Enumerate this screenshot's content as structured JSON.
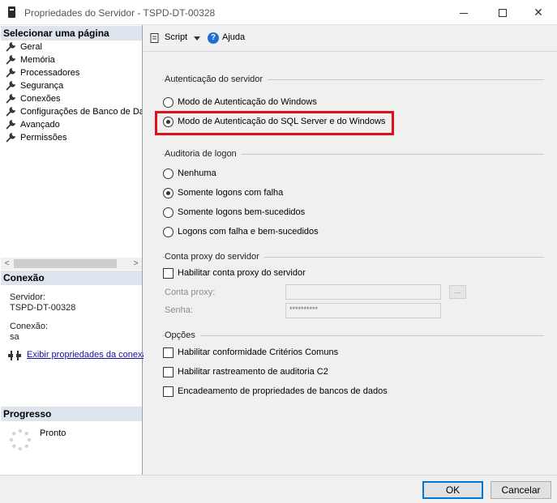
{
  "window": {
    "title": "Propriedades do Servidor - TSPD-DT-00328",
    "close_glyph": "✕"
  },
  "sidebar": {
    "select_page_header": "Selecionar uma página",
    "pages": [
      {
        "label": "Geral"
      },
      {
        "label": "Memória"
      },
      {
        "label": "Processadores"
      },
      {
        "label": "Segurança"
      },
      {
        "label": "Conexões"
      },
      {
        "label": "Configurações de Banco de Da"
      },
      {
        "label": "Avançado"
      },
      {
        "label": "Permissões"
      }
    ],
    "scroll_left": "<",
    "scroll_right": ">",
    "connection": {
      "header": "Conexão",
      "server_label": "Servidor:",
      "server_value": "TSPD-DT-00328",
      "connection_label": "Conexão:",
      "connection_value": "sa",
      "view_link": "Exibir propriedades da conexã"
    },
    "progress": {
      "header": "Progresso",
      "status": "Pronto"
    }
  },
  "toolbar": {
    "script_label": "Script",
    "help_label": "Ajuda",
    "help_glyph": "?"
  },
  "auth": {
    "title": "Autenticação do servidor",
    "options": [
      {
        "label": "Modo de Autenticação do Windows",
        "selected": false
      },
      {
        "label": "Modo de Autenticação do SQL Server e do Windows",
        "selected": true
      }
    ]
  },
  "audit": {
    "title": "Auditoria de logon",
    "options": [
      {
        "label": "Nenhuma",
        "selected": false
      },
      {
        "label": "Somente logons com falha",
        "selected": true
      },
      {
        "label": "Somente logons bem-sucedidos",
        "selected": false
      },
      {
        "label": "Logons com falha e bem-sucedidos",
        "selected": false
      }
    ]
  },
  "proxy": {
    "title": "Conta proxy do servidor",
    "enable_label": "Habilitar conta proxy do servidor",
    "enabled": false,
    "account_label": "Conta proxy:",
    "account_value": "",
    "password_label": "Senha:",
    "password_value": "**********",
    "browse_label": "..."
  },
  "options": {
    "title": "Opções",
    "items": [
      {
        "label": "Habilitar conformidade Critérios Comuns",
        "checked": false
      },
      {
        "label": "Habilitar rastreamento de auditoria C2",
        "checked": false
      },
      {
        "label": "Encadeamento de propriedades de bancos de dados",
        "checked": false
      }
    ]
  },
  "buttons": {
    "ok": "OK",
    "cancel": "Cancelar"
  },
  "colors": {
    "highlight_border": "#e0101b",
    "section_header_bg": "#dde4ee",
    "link": "#1a0dab",
    "ok_border": "#0078d7"
  }
}
